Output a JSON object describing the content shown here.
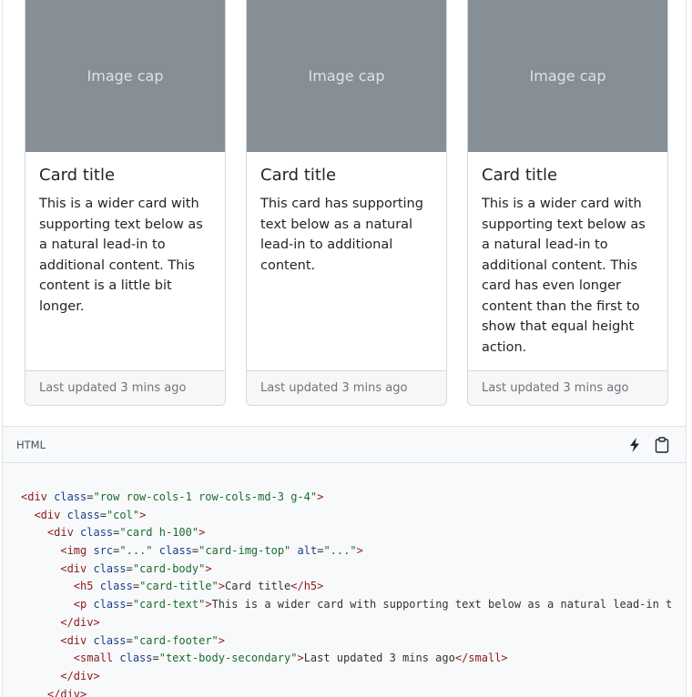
{
  "cards": [
    {
      "image_label": "Image cap",
      "title": "Card title",
      "text": "This is a wider card with supporting text below as a natural lead-in to additional content. This content is a little bit longer.",
      "footer": "Last updated 3 mins ago"
    },
    {
      "image_label": "Image cap",
      "title": "Card title",
      "text": "This card has supporting text below as a natural lead-in to additional content.",
      "footer": "Last updated 3 mins ago"
    },
    {
      "image_label": "Image cap",
      "title": "Card title",
      "text": "This is a wider card with supporting text below as a natural lead-in to additional content. This card has even longer content than the first to show that equal height action.",
      "footer": "Last updated 3 mins ago"
    }
  ],
  "code_header": {
    "language": "HTML",
    "icons": [
      "lightning-icon",
      "clipboard-icon"
    ]
  },
  "code_lines": [
    [
      {
        "c": "t",
        "v": "<div "
      },
      {
        "c": "a",
        "v": "class"
      },
      {
        "c": "p",
        "v": "="
      },
      {
        "c": "s",
        "v": "\"row row-cols-1 row-cols-md-3 g-4\""
      },
      {
        "c": "t",
        "v": ">"
      }
    ],
    [
      {
        "c": "p",
        "v": "  "
      },
      {
        "c": "t",
        "v": "<div "
      },
      {
        "c": "a",
        "v": "class"
      },
      {
        "c": "p",
        "v": "="
      },
      {
        "c": "s",
        "v": "\"col\""
      },
      {
        "c": "t",
        "v": ">"
      }
    ],
    [
      {
        "c": "p",
        "v": "    "
      },
      {
        "c": "t",
        "v": "<div "
      },
      {
        "c": "a",
        "v": "class"
      },
      {
        "c": "p",
        "v": "="
      },
      {
        "c": "s",
        "v": "\"card h-100\""
      },
      {
        "c": "t",
        "v": ">"
      }
    ],
    [
      {
        "c": "p",
        "v": "      "
      },
      {
        "c": "t",
        "v": "<img "
      },
      {
        "c": "a",
        "v": "src"
      },
      {
        "c": "p",
        "v": "="
      },
      {
        "c": "s",
        "v": "\"...\""
      },
      {
        "c": "p",
        "v": " "
      },
      {
        "c": "a",
        "v": "class"
      },
      {
        "c": "p",
        "v": "="
      },
      {
        "c": "s",
        "v": "\"card-img-top\""
      },
      {
        "c": "p",
        "v": " "
      },
      {
        "c": "a",
        "v": "alt"
      },
      {
        "c": "p",
        "v": "="
      },
      {
        "c": "s",
        "v": "\"...\""
      },
      {
        "c": "t",
        "v": ">"
      }
    ],
    [
      {
        "c": "p",
        "v": "      "
      },
      {
        "c": "t",
        "v": "<div "
      },
      {
        "c": "a",
        "v": "class"
      },
      {
        "c": "p",
        "v": "="
      },
      {
        "c": "s",
        "v": "\"card-body\""
      },
      {
        "c": "t",
        "v": ">"
      }
    ],
    [
      {
        "c": "p",
        "v": "        "
      },
      {
        "c": "t",
        "v": "<h5 "
      },
      {
        "c": "a",
        "v": "class"
      },
      {
        "c": "p",
        "v": "="
      },
      {
        "c": "s",
        "v": "\"card-title\""
      },
      {
        "c": "t",
        "v": ">"
      },
      {
        "c": "p",
        "v": "Card title"
      },
      {
        "c": "t",
        "v": "</h5>"
      }
    ],
    [
      {
        "c": "p",
        "v": "        "
      },
      {
        "c": "t",
        "v": "<p "
      },
      {
        "c": "a",
        "v": "class"
      },
      {
        "c": "p",
        "v": "="
      },
      {
        "c": "s",
        "v": "\"card-text\""
      },
      {
        "c": "t",
        "v": ">"
      },
      {
        "c": "p",
        "v": "This is a wider card with supporting text below as a natural lead-in t"
      }
    ],
    [
      {
        "c": "p",
        "v": "      "
      },
      {
        "c": "t",
        "v": "</div>"
      }
    ],
    [
      {
        "c": "p",
        "v": "      "
      },
      {
        "c": "t",
        "v": "<div "
      },
      {
        "c": "a",
        "v": "class"
      },
      {
        "c": "p",
        "v": "="
      },
      {
        "c": "s",
        "v": "\"card-footer\""
      },
      {
        "c": "t",
        "v": ">"
      }
    ],
    [
      {
        "c": "p",
        "v": "        "
      },
      {
        "c": "t",
        "v": "<small "
      },
      {
        "c": "a",
        "v": "class"
      },
      {
        "c": "p",
        "v": "="
      },
      {
        "c": "s",
        "v": "\"text-body-secondary\""
      },
      {
        "c": "t",
        "v": ">"
      },
      {
        "c": "p",
        "v": "Last updated 3 mins ago"
      },
      {
        "c": "t",
        "v": "</small>"
      }
    ],
    [
      {
        "c": "p",
        "v": "      "
      },
      {
        "c": "t",
        "v": "</div>"
      }
    ],
    [
      {
        "c": "p",
        "v": "    "
      },
      {
        "c": "t",
        "v": "</div>"
      }
    ]
  ]
}
